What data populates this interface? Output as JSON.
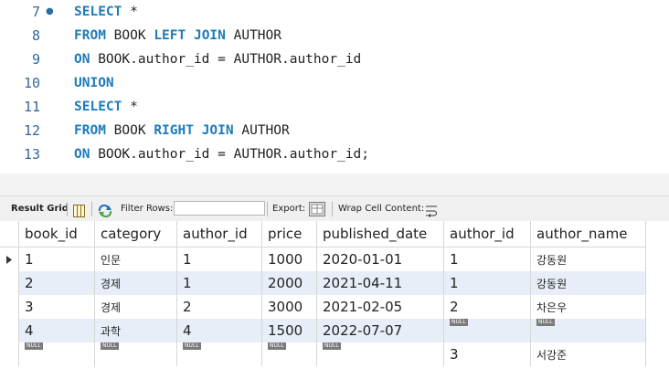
{
  "editor": {
    "lines": [
      {
        "num": "7",
        "tokens": [
          {
            "t": "SELECT",
            "kw": true
          },
          {
            "t": " *",
            "kw": false
          }
        ]
      },
      {
        "num": "8",
        "tokens": [
          {
            "t": "FROM",
            "kw": true
          },
          {
            "t": " BOOK ",
            "kw": false
          },
          {
            "t": "LEFT JOIN",
            "kw": true
          },
          {
            "t": " AUTHOR",
            "kw": false
          }
        ]
      },
      {
        "num": "9",
        "tokens": [
          {
            "t": "ON",
            "kw": true
          },
          {
            "t": " BOOK.author_id = AUTHOR.author_id",
            "kw": false
          }
        ]
      },
      {
        "num": "10",
        "tokens": [
          {
            "t": "UNION",
            "kw": true
          }
        ]
      },
      {
        "num": "11",
        "tokens": [
          {
            "t": "SELECT",
            "kw": true
          },
          {
            "t": " *",
            "kw": false
          }
        ]
      },
      {
        "num": "12",
        "tokens": [
          {
            "t": "FROM",
            "kw": true
          },
          {
            "t": " BOOK ",
            "kw": false
          },
          {
            "t": "RIGHT JOIN",
            "kw": true
          },
          {
            "t": " AUTHOR",
            "kw": false
          }
        ]
      },
      {
        "num": "13",
        "tokens": [
          {
            "t": "ON",
            "kw": true
          },
          {
            "t": " BOOK.author_id = AUTHOR.author_id;",
            "kw": false
          }
        ]
      }
    ]
  },
  "toolbar": {
    "result_grid": "Result Grid",
    "filter_rows": "Filter Rows:",
    "filter_value": "",
    "export": "Export:",
    "wrap_cell": "Wrap Cell Content:"
  },
  "grid": {
    "columns": [
      "book_id",
      "category",
      "author_id",
      "price",
      "published_date",
      "author_id",
      "author_name"
    ],
    "null_label": "NULL",
    "rows": [
      [
        "1",
        "인문",
        "1",
        "1000",
        "2020-01-01",
        "1",
        "강동원"
      ],
      [
        "2",
        "경제",
        "1",
        "2000",
        "2021-04-11",
        "1",
        "강동원"
      ],
      [
        "3",
        "경제",
        "2",
        "3000",
        "2021-02-05",
        "2",
        "차은우"
      ],
      [
        "4",
        "과학",
        "4",
        "1500",
        "2022-07-07",
        null,
        null
      ],
      [
        null,
        null,
        null,
        null,
        null,
        "3",
        "서강준"
      ]
    ]
  }
}
